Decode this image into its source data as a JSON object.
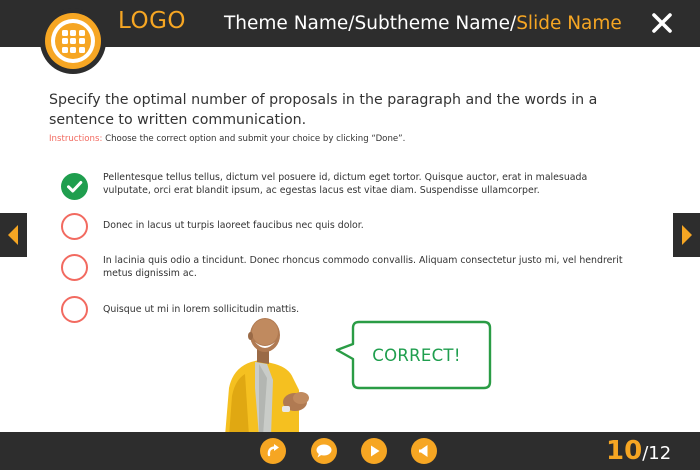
{
  "header": {
    "logo_text": "LOGO",
    "breadcrumb": {
      "theme": "Theme Name",
      "subtheme": "Subtheme Name",
      "slide": "Slide Name",
      "separator": "/"
    },
    "close_icon": "close-icon"
  },
  "question": {
    "text": "Specify the optimal number of proposals in the paragraph and the words in a sentence to written communication.",
    "instructions_label": "Instructions:",
    "instructions_text": "Choose the correct option and submit your choice by clicking “Done”."
  },
  "options": [
    {
      "text": "Pellentesque tellus tellus, dictum vel posuere id, dictum eget tortor. Quisque auctor, erat in malesuada vulputate, orci erat blandit ipsum, ac egestas lacus est vitae diam. Suspendisse ullamcorper.",
      "selected": true
    },
    {
      "text": "Donec in lacus ut turpis laoreet faucibus nec quis dolor.",
      "selected": false
    },
    {
      "text": "In lacinia quis odio a tincidunt. Donec rhoncus commodo convallis. Aliquam consectetur justo mi, vel hendrerit metus dignissim ac.",
      "selected": false
    },
    {
      "text": "Quisque ut mi in lorem sollicitudin mattis.",
      "selected": false
    }
  ],
  "feedback": {
    "text": "CORRECT!"
  },
  "navigation": {
    "prev_icon": "left-arrow-icon",
    "next_icon": "right-arrow-icon"
  },
  "footer": {
    "buttons": [
      "replay-icon",
      "comment-icon",
      "play-icon",
      "volume-icon"
    ],
    "current_slide": "10",
    "total_slides": "/12"
  },
  "colors": {
    "bar": "#2d2d2d",
    "accent": "#f6a623",
    "correct": "#1f9e4e",
    "option_outline": "#f26a60"
  }
}
